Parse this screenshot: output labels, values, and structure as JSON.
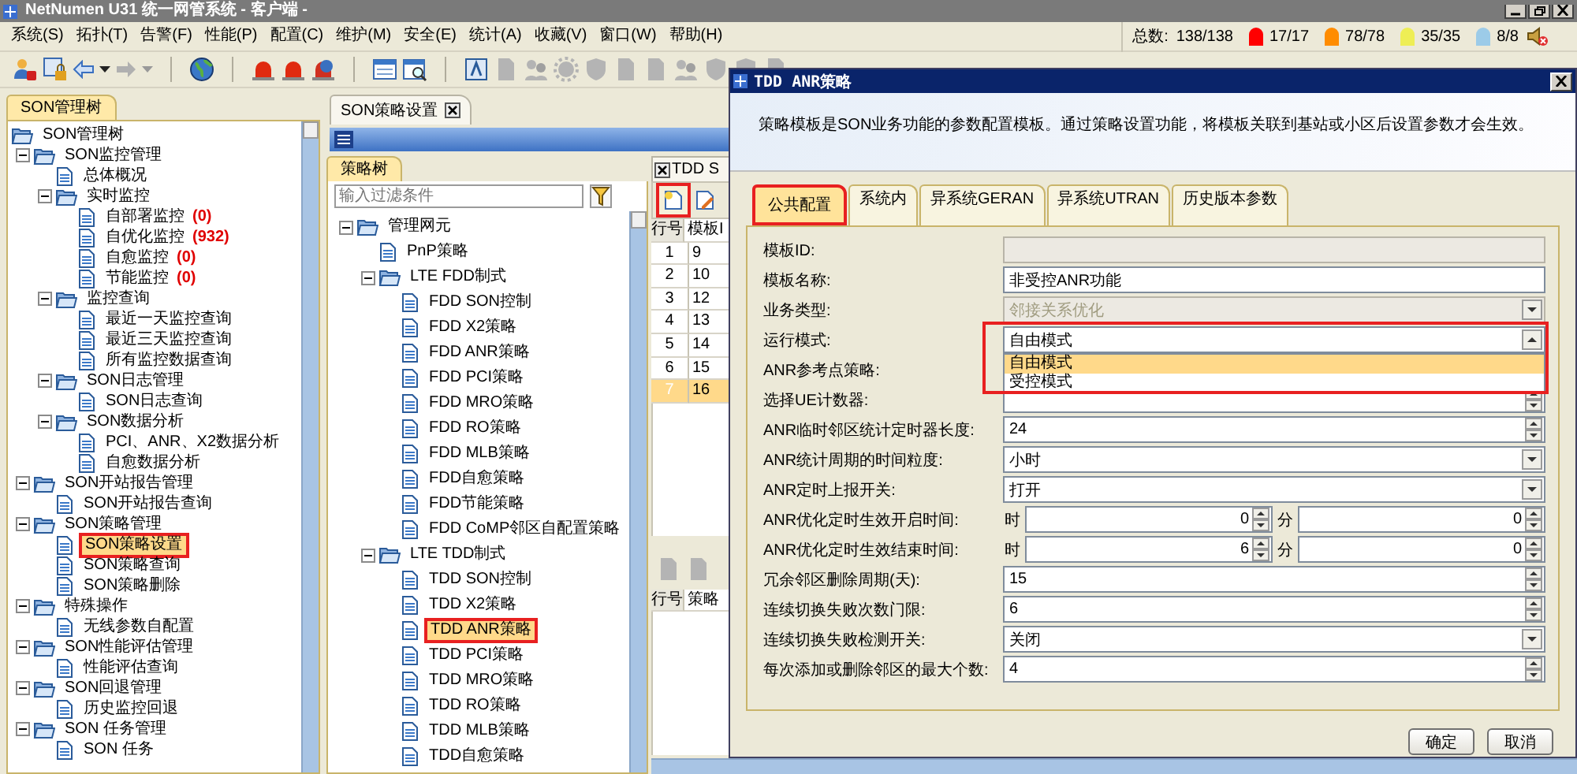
{
  "app_title": "NetNumen U31 统一网管系统 - 客户端 -",
  "menu": [
    "系统(S)",
    "拓扑(T)",
    "告警(F)",
    "性能(P)",
    "配置(C)",
    "维护(M)",
    "安全(E)",
    "统计(A)",
    "收藏(V)",
    "窗口(W)",
    "帮助(H)"
  ],
  "alarm_summary": {
    "label": "总数:",
    "total": "138/138",
    "levels": [
      {
        "count": "17/17",
        "color": "#ff0000"
      },
      {
        "count": "78/78",
        "color": "#ff8c00"
      },
      {
        "count": "35/35",
        "color": "#eeee55"
      },
      {
        "count": "8/8",
        "color": "#9ccbe8"
      }
    ]
  },
  "left_panel": {
    "tab": "SON管理树",
    "tree": [
      {
        "label": "SON管理树",
        "kind": "folder",
        "selected": false,
        "children": [
          {
            "label": "SON监控管理",
            "kind": "folder",
            "expanded": true,
            "selected": false,
            "children": [
              {
                "label": "总体概况",
                "kind": "leaf",
                "selected": false
              },
              {
                "label": "实时监控",
                "kind": "folder",
                "expanded": true,
                "selected": false,
                "children": [
                  {
                    "label": "自部署监控",
                    "kind": "leaf",
                    "count": "(0)",
                    "selected": false
                  },
                  {
                    "label": "自优化监控",
                    "kind": "leaf",
                    "count": "(932)",
                    "selected": false
                  },
                  {
                    "label": "自愈监控",
                    "kind": "leaf",
                    "count": "(0)",
                    "selected": false
                  },
                  {
                    "label": "节能监控",
                    "kind": "leaf",
                    "count": "(0)",
                    "selected": false
                  }
                ]
              },
              {
                "label": "监控查询",
                "kind": "folder",
                "expanded": true,
                "selected": false,
                "children": [
                  {
                    "label": "最近一天监控查询",
                    "kind": "leaf",
                    "selected": false
                  },
                  {
                    "label": "最近三天监控查询",
                    "kind": "leaf",
                    "selected": false
                  },
                  {
                    "label": "所有监控数据查询",
                    "kind": "leaf",
                    "selected": false
                  }
                ]
              },
              {
                "label": "SON日志管理",
                "kind": "folder",
                "expanded": true,
                "selected": false,
                "children": [
                  {
                    "label": "SON日志查询",
                    "kind": "leaf",
                    "selected": false
                  }
                ]
              },
              {
                "label": "SON数据分析",
                "kind": "folder",
                "expanded": true,
                "selected": false,
                "children": [
                  {
                    "label": "PCI、ANR、X2数据分析",
                    "kind": "leaf",
                    "selected": false
                  },
                  {
                    "label": "自愈数据分析",
                    "kind": "leaf",
                    "selected": false
                  }
                ]
              }
            ]
          },
          {
            "label": "SON开站报告管理",
            "kind": "folder",
            "expanded": true,
            "selected": false,
            "children": [
              {
                "label": "SON开站报告查询",
                "kind": "leaf",
                "selected": false
              }
            ]
          },
          {
            "label": "SON策略管理",
            "kind": "folder",
            "expanded": true,
            "selected": false,
            "children": [
              {
                "label": "SON策略设置",
                "kind": "leaf",
                "selected": true,
                "annotated": true
              },
              {
                "label": "SON策略查询",
                "kind": "leaf",
                "selected": false
              },
              {
                "label": "SON策略删除",
                "kind": "leaf",
                "selected": false
              }
            ]
          },
          {
            "label": "特殊操作",
            "kind": "folder",
            "expanded": true,
            "selected": false,
            "children": [
              {
                "label": "无线参数自配置",
                "kind": "leaf",
                "selected": false
              }
            ]
          },
          {
            "label": "SON性能评估管理",
            "kind": "folder",
            "expanded": true,
            "selected": false,
            "children": [
              {
                "label": "性能评估查询",
                "kind": "leaf",
                "selected": false
              }
            ]
          },
          {
            "label": "SON回退管理",
            "kind": "folder",
            "expanded": true,
            "selected": false,
            "children": [
              {
                "label": "历史监控回退",
                "kind": "leaf",
                "selected": false
              }
            ]
          },
          {
            "label": "SON 任务管理",
            "kind": "folder",
            "expanded": true,
            "selected": false,
            "children": [
              {
                "label": "SON 任务",
                "kind": "leaf",
                "selected": false
              }
            ]
          }
        ]
      }
    ]
  },
  "editor": {
    "tab": "SON策略设置",
    "policy_tree": {
      "tab": "策略树",
      "filter_placeholder": "输入过滤条件",
      "tree": [
        {
          "label": "管理网元",
          "kind": "folder",
          "expanded": true,
          "selected": false,
          "children": [
            {
              "label": "PnP策略",
              "kind": "leaf",
              "selected": false
            },
            {
              "label": "LTE FDD制式",
              "kind": "folder",
              "expanded": true,
              "selected": false,
              "children": [
                {
                  "label": "FDD SON控制",
                  "kind": "leaf",
                  "selected": false
                },
                {
                  "label": "FDD X2策略",
                  "kind": "leaf",
                  "selected": false
                },
                {
                  "label": "FDD ANR策略",
                  "kind": "leaf",
                  "selected": false
                },
                {
                  "label": "FDD PCI策略",
                  "kind": "leaf",
                  "selected": false
                },
                {
                  "label": "FDD MRO策略",
                  "kind": "leaf",
                  "selected": false
                },
                {
                  "label": "FDD RO策略",
                  "kind": "leaf",
                  "selected": false
                },
                {
                  "label": "FDD MLB策略",
                  "kind": "leaf",
                  "selected": false
                },
                {
                  "label": "FDD自愈策略",
                  "kind": "leaf",
                  "selected": false
                },
                {
                  "label": "FDD节能策略",
                  "kind": "leaf",
                  "selected": false
                },
                {
                  "label": "FDD CoMP邻区自配置策略",
                  "kind": "leaf",
                  "selected": false
                }
              ]
            },
            {
              "label": "LTE TDD制式",
              "kind": "folder",
              "expanded": true,
              "selected": false,
              "children": [
                {
                  "label": "TDD SON控制",
                  "kind": "leaf",
                  "selected": false
                },
                {
                  "label": "TDD X2策略",
                  "kind": "leaf",
                  "selected": false
                },
                {
                  "label": "TDD ANR策略",
                  "kind": "leaf",
                  "selected": true,
                  "annotated": true
                },
                {
                  "label": "TDD PCI策略",
                  "kind": "leaf",
                  "selected": false
                },
                {
                  "label": "TDD MRO策略",
                  "kind": "leaf",
                  "selected": false
                },
                {
                  "label": "TDD RO策略",
                  "kind": "leaf",
                  "selected": false
                },
                {
                  "label": "TDD MLB策略",
                  "kind": "leaf",
                  "selected": false
                },
                {
                  "label": "TDD自愈策略",
                  "kind": "leaf",
                  "selected": false
                }
              ]
            }
          ]
        }
      ]
    },
    "template_panel": {
      "tab": "TDD S",
      "new_button_annotated": true,
      "columns": [
        "行号",
        "模板I"
      ],
      "rows": [
        {
          "no": "1",
          "id": "9",
          "selected": false
        },
        {
          "no": "2",
          "id": "10",
          "selected": false
        },
        {
          "no": "3",
          "id": "12",
          "selected": false
        },
        {
          "no": "4",
          "id": "13",
          "selected": false
        },
        {
          "no": "5",
          "id": "14",
          "selected": false
        },
        {
          "no": "6",
          "id": "15",
          "selected": false
        },
        {
          "no": "7",
          "id": "16",
          "selected": true
        }
      ],
      "lower_columns": [
        "行号",
        "策略"
      ]
    }
  },
  "dialog": {
    "title": "TDD ANR策略",
    "description": "策略模板是SON业务功能的参数配置模板。通过策略设置功能，将模板关联到基站或小区后设置参数才会生效。",
    "tabs": [
      {
        "label": "公共配置",
        "selected": true,
        "annotated": true
      },
      {
        "label": "系统内",
        "selected": false
      },
      {
        "label": "异系统GERAN",
        "selected": false
      },
      {
        "label": "异系统UTRAN",
        "selected": false
      },
      {
        "label": "历史版本参数",
        "selected": false
      }
    ],
    "fields": [
      {
        "label": "模板ID:",
        "kind": "text",
        "disabled": true
      },
      {
        "label": "模板名称:",
        "kind": "text",
        "value": "非受控ANR功能",
        "disabled": false
      },
      {
        "label": "业务类型:",
        "kind": "combo",
        "value": "邻接关系优化",
        "disabled": true
      },
      {
        "label": "运行模式:",
        "kind": "combo",
        "value": "自由模式",
        "disabled": false,
        "expanded": true,
        "annotated": true,
        "options": [
          {
            "label": "自由模式",
            "selected": true
          },
          {
            "label": "受控模式",
            "selected": false
          }
        ]
      },
      {
        "label": "ANR参考点策略:",
        "kind": "hidden"
      },
      {
        "label": "选择UE计数器:",
        "kind": "spin",
        "disabled": false
      },
      {
        "label": "ANR临时邻区统计定时器长度:",
        "kind": "spin",
        "value": "24",
        "disabled": false
      },
      {
        "label": "ANR统计周期的时间粒度:",
        "kind": "combo",
        "value": "小时",
        "disabled": false
      },
      {
        "label": "ANR定时上报开关:",
        "kind": "combo",
        "value": "打开",
        "disabled": false
      },
      {
        "label": "ANR优化定时生效开启时间:",
        "kind": "time",
        "hour_unit": "时",
        "hour": "0",
        "minute_unit": "分",
        "minute": "0",
        "disabled": false
      },
      {
        "label": "ANR优化定时生效结束时间:",
        "kind": "time",
        "hour_unit": "时",
        "hour": "6",
        "minute_unit": "分",
        "minute": "0",
        "disabled": false
      },
      {
        "label": "冗余邻区删除周期(天):",
        "kind": "spin",
        "value": "15",
        "disabled": false
      },
      {
        "label": "连续切换失败次数门限:",
        "kind": "spin",
        "value": "6",
        "disabled": false
      },
      {
        "label": "连续切换失败检测开关:",
        "kind": "combo",
        "value": "关闭",
        "disabled": false
      },
      {
        "label": "每次添加或删除邻区的最大个数:",
        "kind": "spin",
        "value": "4",
        "disabled": false
      }
    ],
    "buttons": [
      "确定",
      "取消"
    ]
  }
}
